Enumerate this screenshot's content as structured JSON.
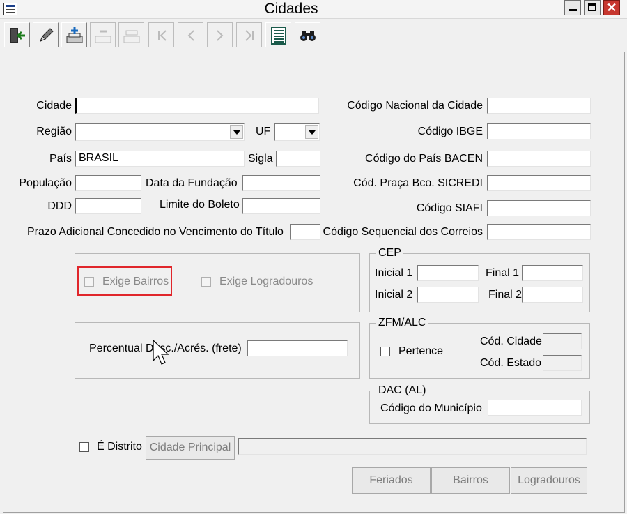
{
  "window": {
    "title": "Cidades",
    "close_glyph": "✕"
  },
  "toolbar": {
    "buttons": [
      {
        "name": "exit-door-icon",
        "enabled": true
      },
      {
        "name": "pencil-edit-icon",
        "enabled": true
      },
      {
        "name": "add-record-icon",
        "enabled": true
      },
      {
        "name": "delete-record-icon",
        "enabled": false
      },
      {
        "name": "save-record-icon",
        "enabled": false
      },
      {
        "name": "first-record-icon",
        "enabled": false
      },
      {
        "name": "previous-record-icon",
        "enabled": false
      },
      {
        "name": "next-record-icon",
        "enabled": false
      },
      {
        "name": "last-record-icon",
        "enabled": false
      },
      {
        "name": "list-view-icon",
        "enabled": true
      },
      {
        "name": "binoculars-search-icon",
        "enabled": true
      }
    ]
  },
  "form": {
    "cidade": {
      "label": "Cidade",
      "value": ""
    },
    "regiao": {
      "label": "Região",
      "value": ""
    },
    "uf": {
      "label": "UF",
      "value": ""
    },
    "pais": {
      "label": "País",
      "value": "BRASIL"
    },
    "sigla": {
      "label": "Sigla",
      "value": ""
    },
    "populacao": {
      "label": "População",
      "value": ""
    },
    "data_fundacao": {
      "label": "Data da Fundação",
      "value": ""
    },
    "ddd": {
      "label": "DDD",
      "value": ""
    },
    "limite_boleto": {
      "label": "Limite do Boleto",
      "value": ""
    },
    "prazo_adicional": {
      "label": "Prazo Adicional Concedido no Vencimento do Título",
      "value": ""
    },
    "codigo_nacional": {
      "label": "Código Nacional da Cidade",
      "value": ""
    },
    "codigo_ibge": {
      "label": "Código IBGE",
      "value": ""
    },
    "codigo_pais_bacen": {
      "label": "Código do País BACEN",
      "value": ""
    },
    "cod_praca_sicredi": {
      "label": "Cód. Praça Bco. SICREDI",
      "value": ""
    },
    "codigo_siafi": {
      "label": "Código SIAFI",
      "value": ""
    },
    "codigo_sequencial_correios": {
      "label": "Código Sequencial dos Correios",
      "value": ""
    }
  },
  "options_group": {
    "exige_bairros": {
      "label": "Exige Bairros",
      "checked": false,
      "enabled": false
    },
    "exige_logradouros": {
      "label": "Exige Logradouros",
      "checked": false,
      "enabled": false
    }
  },
  "percentual": {
    "label": "Percentual Desc./Acrés. (frete)",
    "value": ""
  },
  "cep": {
    "title": "CEP",
    "inicial1": {
      "label": "Inicial 1",
      "value": ""
    },
    "final1": {
      "label": "Final 1",
      "value": ""
    },
    "inicial2": {
      "label": "Inicial 2",
      "value": ""
    },
    "final2": {
      "label": "Final 2",
      "value": ""
    }
  },
  "zfm": {
    "title": "ZFM/ALC",
    "pertence": {
      "label": "Pertence",
      "checked": false
    },
    "cod_cidade": {
      "label": "Cód. Cidade",
      "value": ""
    },
    "cod_estado": {
      "label": "Cód. Estado",
      "value": ""
    }
  },
  "dac": {
    "title": "DAC (AL)",
    "codigo_municipio": {
      "label": "Código do Município",
      "value": ""
    }
  },
  "distrito": {
    "e_distrito": {
      "label": "É Distrito",
      "checked": false
    },
    "cidade_principal_button": "Cidade Principal",
    "cidade_principal_value": ""
  },
  "actions": {
    "feriados": "Feriados",
    "bairros": "Bairros",
    "logradouros": "Logradouros"
  },
  "colors": {
    "highlight": "#e0262b",
    "close_button": "#c7372f"
  }
}
